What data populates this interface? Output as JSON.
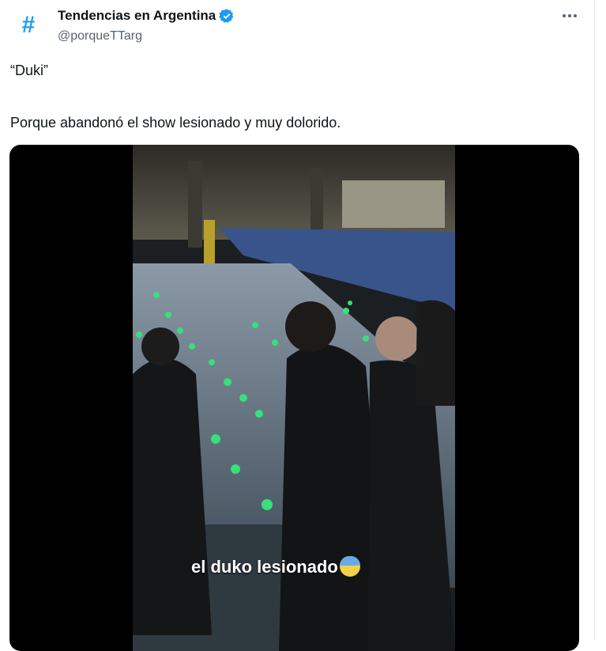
{
  "tweet": {
    "avatar_glyph": "#",
    "name": "Tendencias en Argentina",
    "handle": "@porqueTTarg",
    "text_line1": "“Duki”",
    "text_line2": "Porque abandonó el show lesionado y muy dolorido.",
    "video_caption": "el duko lesionado",
    "icons": {
      "verified": "verified-badge-icon",
      "more": "more-options-icon",
      "emoji": "anxious-face-emoji"
    },
    "colors": {
      "brand": "#1d9bf0",
      "text": "#0f1419",
      "secondary": "#536471"
    }
  }
}
